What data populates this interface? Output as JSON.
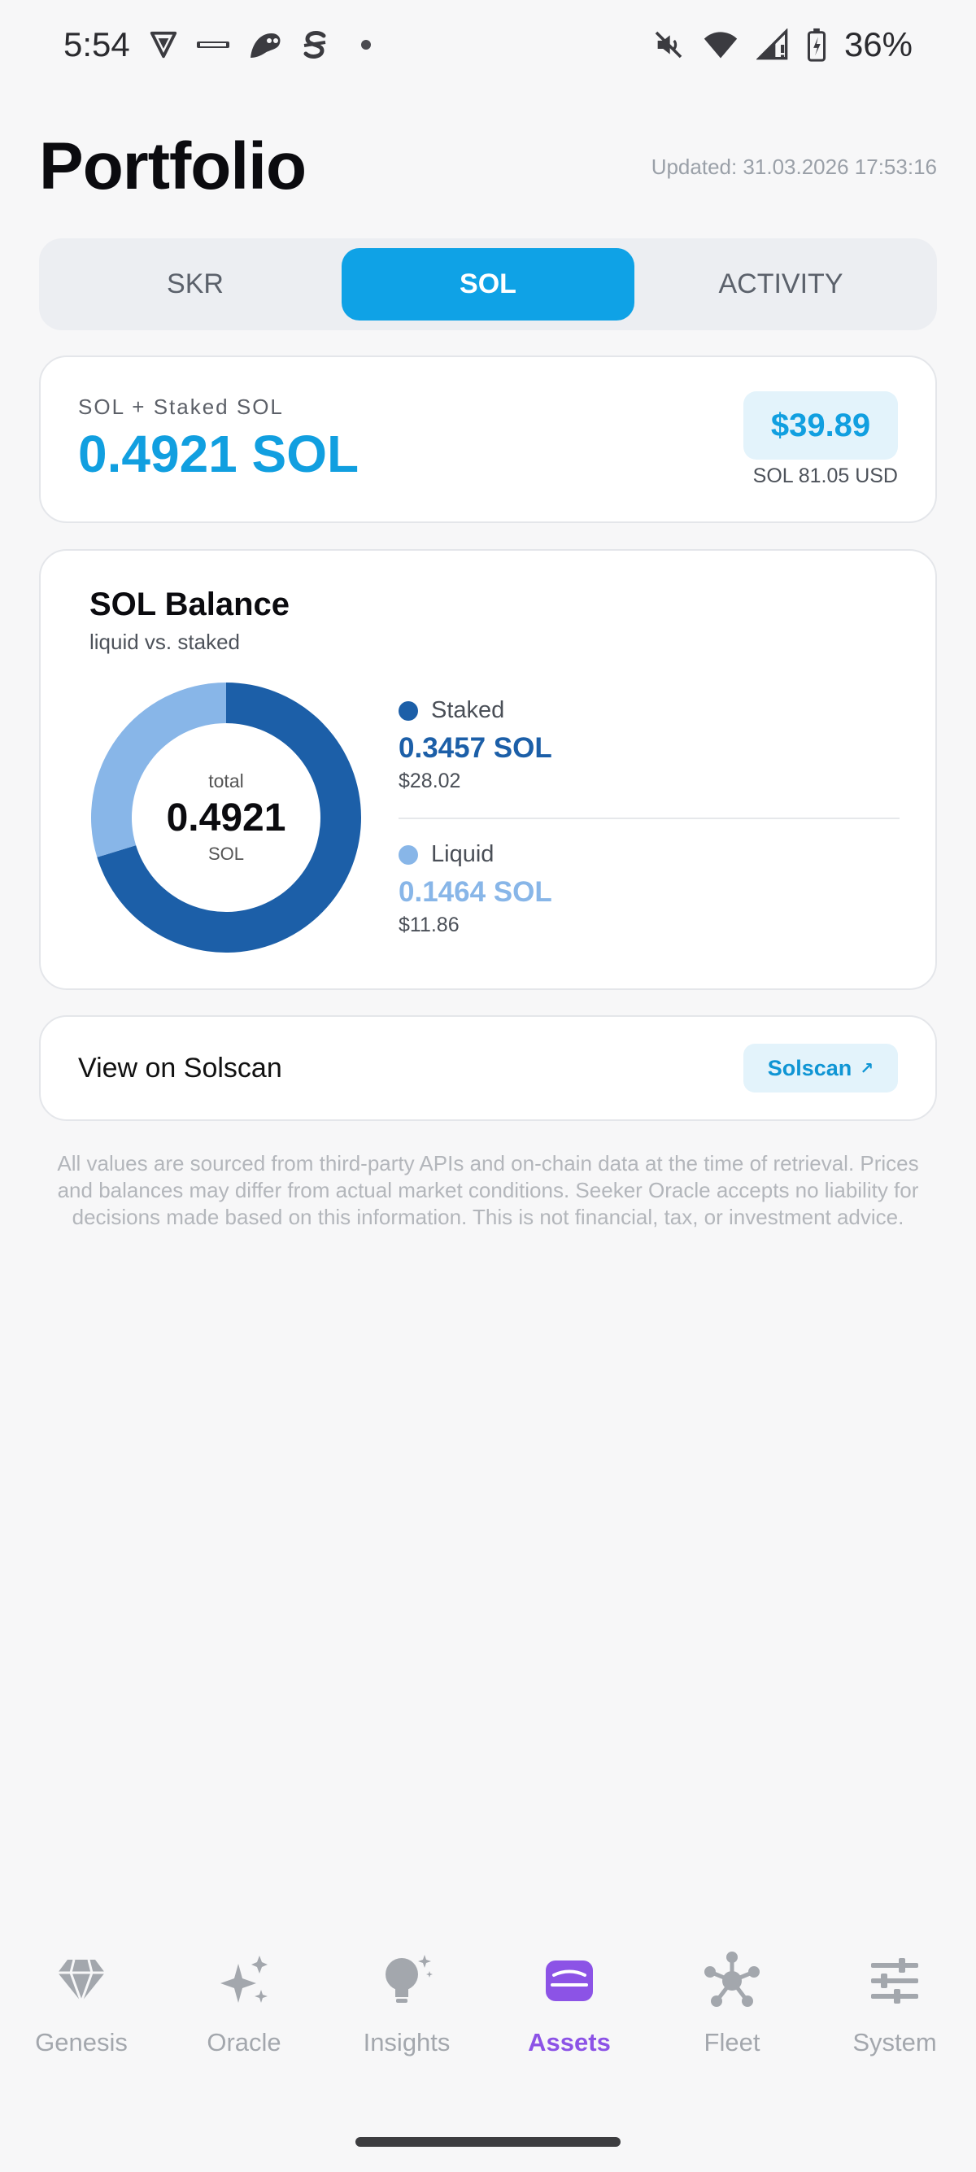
{
  "status_bar": {
    "time": "5:54",
    "battery": "36%",
    "icons": [
      "vpn-shield-icon",
      "carrier-logo-icon",
      "app-bird-icon",
      "app-s-icon",
      "notification-dot-icon",
      "mute-icon",
      "wifi-icon",
      "signal-icon",
      "battery-charging-icon"
    ]
  },
  "header": {
    "title": "Portfolio",
    "updated": "Updated: 31.03.2026 17:53:16"
  },
  "tabs": [
    {
      "label": "SKR",
      "active": false
    },
    {
      "label": "SOL",
      "active": true
    },
    {
      "label": "ACTIVITY",
      "active": false
    }
  ],
  "total_card": {
    "label": "SOL + Staked SOL",
    "value": "0.4921 SOL",
    "usd_value": "$39.89",
    "price": "SOL 81.05 USD"
  },
  "balance_card": {
    "title": "SOL Balance",
    "subtitle": "liquid vs. staked",
    "center": {
      "top": "total",
      "value": "0.4921",
      "unit": "SOL"
    },
    "staked": {
      "name": "Staked",
      "amount": "0.3457 SOL",
      "usd": "$28.02",
      "color": "#1c5fa8"
    },
    "liquid": {
      "name": "Liquid",
      "amount": "0.1464 SOL",
      "usd": "$11.86",
      "color": "#88b6e8"
    }
  },
  "chart_data": {
    "type": "pie",
    "categories": [
      "Staked",
      "Liquid"
    ],
    "values": [
      0.3457,
      0.1464
    ],
    "colors": [
      "#1c5fa8",
      "#88b6e8"
    ],
    "title": "SOL Balance",
    "subtitle": "liquid vs. staked"
  },
  "solscan": {
    "label": "View on Solscan",
    "button": "Solscan",
    "arrow": "↗"
  },
  "disclaimer": "All values are sourced from third-party APIs and on-chain data at the time of retrieval. Prices and balances may differ from actual market conditions. Seeker Oracle accepts no liability for decisions made based on this information. This is not financial, tax, or investment advice.",
  "bottom_nav": [
    {
      "label": "Genesis",
      "icon": "diamond-icon",
      "active": false
    },
    {
      "label": "Oracle",
      "icon": "sparkles-icon",
      "active": false
    },
    {
      "label": "Insights",
      "icon": "lightbulb-icon",
      "active": false
    },
    {
      "label": "Assets",
      "icon": "wallet-icon",
      "active": true
    },
    {
      "label": "Fleet",
      "icon": "network-icon",
      "active": false
    },
    {
      "label": "System",
      "icon": "sliders-icon",
      "active": false
    }
  ],
  "colors": {
    "accent": "#0fa2e6",
    "nav_active": "#8c53e6",
    "staked": "#1c5fa8",
    "liquid": "#88b6e8"
  }
}
